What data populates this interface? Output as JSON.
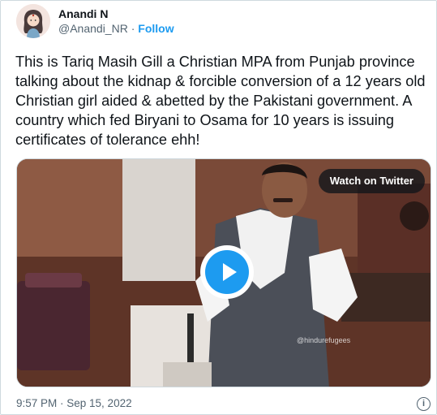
{
  "author": {
    "name": "Anandi N",
    "handle": "@Anandi_NR",
    "separator": "·",
    "follow_label": "Follow"
  },
  "tweet": {
    "text": "This is Tariq Masih Gill a Christian MPA from Punjab province talking about the kidnap & forcible conversion of a 12 years old Christian girl aided & abetted by the Pakistani government. A country which fed Biryani to Osama for 10 years is issuing certificates of tolerance ehh!",
    "timestamp": "9:57 PM · Sep 15, 2022"
  },
  "media": {
    "watch_label": "Watch on Twitter",
    "watermark": "@hindurefugees",
    "play_icon": "play-icon"
  },
  "footer": {
    "info_icon": "info-icon",
    "info_glyph": "i"
  },
  "colors": {
    "accent": "#1d9bf0",
    "text": "#0f1419",
    "muted": "#536471",
    "border": "#cfd9de"
  }
}
